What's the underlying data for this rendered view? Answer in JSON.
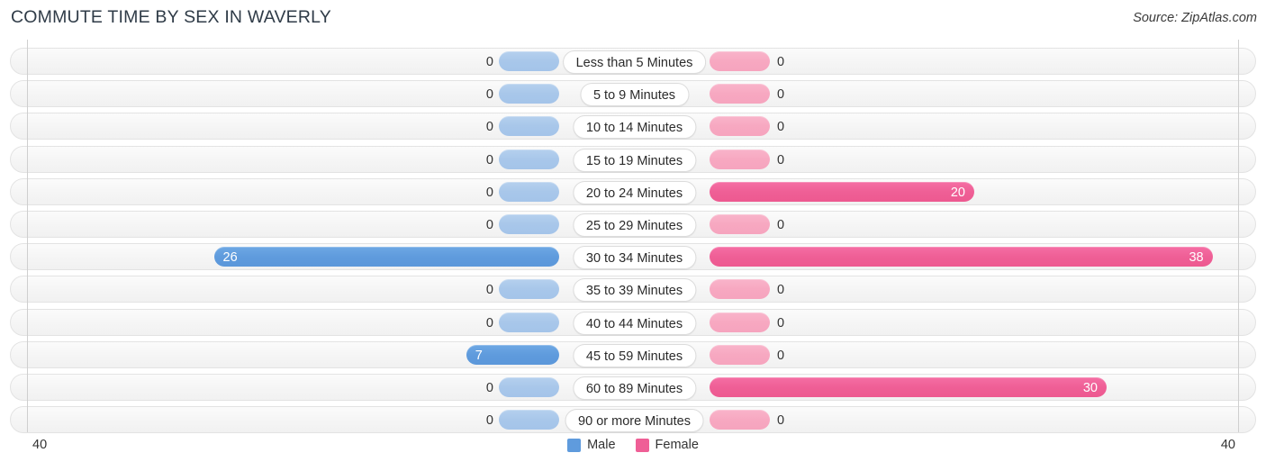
{
  "header": {
    "title": "COMMUTE TIME BY SEX IN WAVERLY",
    "source": "Source: ZipAtlas.com"
  },
  "legend": {
    "male_label": "Male",
    "female_label": "Female",
    "male_color": "#5f9bdd",
    "female_color": "#ef5f96"
  },
  "axis": {
    "left_end_label": "40",
    "right_end_label": "40",
    "max": 40
  },
  "chart_data": {
    "type": "bar",
    "orientation": "horizontal-diverging",
    "title": "COMMUTE TIME BY SEX IN WAVERLY",
    "xlabel": "",
    "ylabel": "",
    "xlim": [
      40,
      40
    ],
    "grid": false,
    "legend_position": "bottom-center",
    "categories": [
      "Less than 5 Minutes",
      "5 to 9 Minutes",
      "10 to 14 Minutes",
      "15 to 19 Minutes",
      "20 to 24 Minutes",
      "25 to 29 Minutes",
      "30 to 34 Minutes",
      "35 to 39 Minutes",
      "40 to 44 Minutes",
      "45 to 59 Minutes",
      "60 to 89 Minutes",
      "90 or more Minutes"
    ],
    "series": [
      {
        "name": "Male",
        "color": "#5f9bdd",
        "values": [
          0,
          0,
          0,
          0,
          0,
          0,
          26,
          0,
          0,
          7,
          0,
          0
        ]
      },
      {
        "name": "Female",
        "color": "#ef5f96",
        "values": [
          0,
          0,
          0,
          0,
          20,
          0,
          38,
          0,
          0,
          0,
          30,
          0
        ]
      }
    ]
  },
  "rows": [
    {
      "label": "Less than 5 Minutes",
      "male": "0",
      "female": "0"
    },
    {
      "label": "5 to 9 Minutes",
      "male": "0",
      "female": "0"
    },
    {
      "label": "10 to 14 Minutes",
      "male": "0",
      "female": "0"
    },
    {
      "label": "15 to 19 Minutes",
      "male": "0",
      "female": "0"
    },
    {
      "label": "20 to 24 Minutes",
      "male": "0",
      "female": "20"
    },
    {
      "label": "25 to 29 Minutes",
      "male": "0",
      "female": "0"
    },
    {
      "label": "30 to 34 Minutes",
      "male": "26",
      "female": "38"
    },
    {
      "label": "35 to 39 Minutes",
      "male": "0",
      "female": "0"
    },
    {
      "label": "40 to 44 Minutes",
      "male": "0",
      "female": "0"
    },
    {
      "label": "45 to 59 Minutes",
      "male": "7",
      "female": "0"
    },
    {
      "label": "60 to 89 Minutes",
      "male": "0",
      "female": "30"
    },
    {
      "label": "90 or more Minutes",
      "male": "0",
      "female": "0"
    }
  ]
}
